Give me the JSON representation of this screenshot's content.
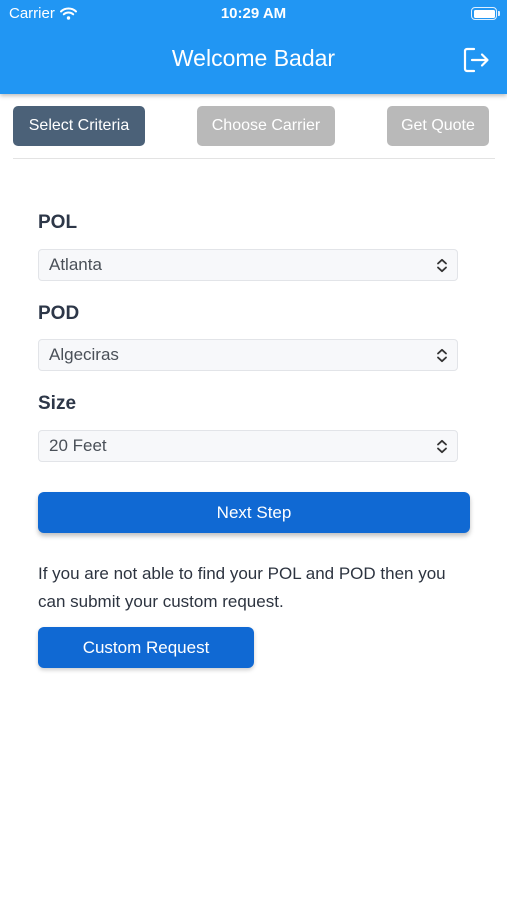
{
  "status_bar": {
    "carrier": "Carrier",
    "time": "10:29 AM",
    "wifi_icon": "wifi-icon",
    "battery_icon": "battery-icon"
  },
  "header": {
    "title": "Welcome Badar",
    "logout_icon": "logout-icon",
    "background": "#2196f3"
  },
  "steps": [
    {
      "label": "Select Criteria",
      "state": "active"
    },
    {
      "label": "Choose Carrier",
      "state": "inactive"
    },
    {
      "label": "Get Quote",
      "state": "inactive"
    }
  ],
  "form": {
    "pol": {
      "label": "POL",
      "value": "Atlanta"
    },
    "pod": {
      "label": "POD",
      "value": "Algeciras"
    },
    "size": {
      "label": "Size",
      "value": "20 Feet"
    },
    "chevron_icon": "chevron-up-down-icon"
  },
  "actions": {
    "next_label": "Next Step",
    "info_text": "If you are not able to find your POL and POD then you can submit your custom request.",
    "custom_label": "Custom Request",
    "primary_color": "#1069d3"
  },
  "colors": {
    "step_active": "#4b6178",
    "step_inactive": "#b9b9b9"
  }
}
